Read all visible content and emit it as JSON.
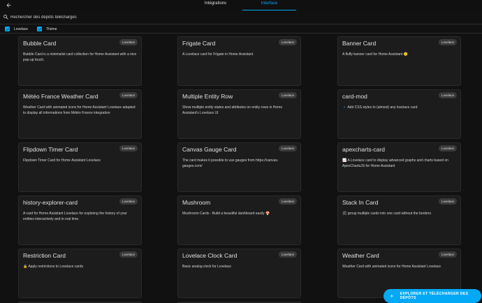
{
  "header": {
    "tabs": [
      {
        "label": "Intégrations",
        "active": false
      },
      {
        "label": "Interface",
        "active": true
      }
    ]
  },
  "search": {
    "placeholder": "Rechercher des dépôts téléchargés",
    "value": ""
  },
  "filters": [
    {
      "label": "Lovelace",
      "checked": true
    },
    {
      "label": "Thème",
      "checked": true
    }
  ],
  "cards": [
    {
      "title": "Bubble Card",
      "badge": "Lovelace",
      "description": "Bubble Card is a minimalist card collection for Home Assistant with a nice pop-up touch."
    },
    {
      "title": "Frigate Card",
      "badge": "Lovelace",
      "description": "A Lovelace card for Frigate in Home Assistant"
    },
    {
      "title": "Banner Card",
      "badge": "Lovelace",
      "description": "A fluffy banner card for Home Assistant 🙂"
    },
    {
      "title": "Météo France Weather Card",
      "badge": "Lovelace",
      "description": "Weather Card with animated icons for Home Assistant Lovelace adapted to display all informations from Météo France integration"
    },
    {
      "title": "Multiple Entity Row",
      "badge": "Lovelace",
      "description": "Show multiple entity states and attributes on entity rows in Home Assistant's Lovelace UI"
    },
    {
      "title": "card-mod",
      "badge": "Lovelace",
      "description": "🔹 Add CSS styles to (almost) any lovelace card"
    },
    {
      "title": "Flipdown Timer Card",
      "badge": "Lovelace",
      "description": "Flipdown Timer Card for Home Assistant Lovelace"
    },
    {
      "title": "Canvas Gauge Card",
      "badge": "Lovelace",
      "description": "The card makes it possible to use gauges from https://canvas-gauges.com/"
    },
    {
      "title": "apexcharts-card",
      "badge": "Lovelace",
      "description": "📈 A Lovelace card to display advanced graphs and charts based on ApexChartsJS for Home Assistant"
    },
    {
      "title": "history-explorer-card",
      "badge": "Lovelace",
      "description": "A card for Home Assistant Lovelace for exploring the history of your entities interactively and in real time."
    },
    {
      "title": "Mushroom",
      "badge": "Lovelace",
      "description": "Mushroom Cards - Build a beautiful dashboard easily 🍄"
    },
    {
      "title": "Stack In Card",
      "badge": "Lovelace",
      "description": "🛠 group multiple cards into one card without the borders"
    },
    {
      "title": "Restriction Card",
      "badge": "Lovelace",
      "description": "🔒 Apply restrictions to Lovelace cards"
    },
    {
      "title": "Lovelace Clock Card",
      "badge": "Lovelace",
      "description": "Basic analog clock for Lovelace"
    },
    {
      "title": "Weather Card",
      "badge": "Lovelace",
      "description": "Weather Card with animated icons for Home Assistant Lovelace"
    }
  ],
  "fab": {
    "label": "EXPLORER ET TÉLÉCHARGER DES DÉPÔTS"
  },
  "colors": {
    "accent": "#03a9f4",
    "background": "#111111",
    "card": "#1c1c1c",
    "badge": "#3a3a3a"
  },
  "icons": {
    "back": "arrow-left-icon",
    "search": "search-icon",
    "checkbox": "check-icon",
    "fab": "plus-icon"
  }
}
